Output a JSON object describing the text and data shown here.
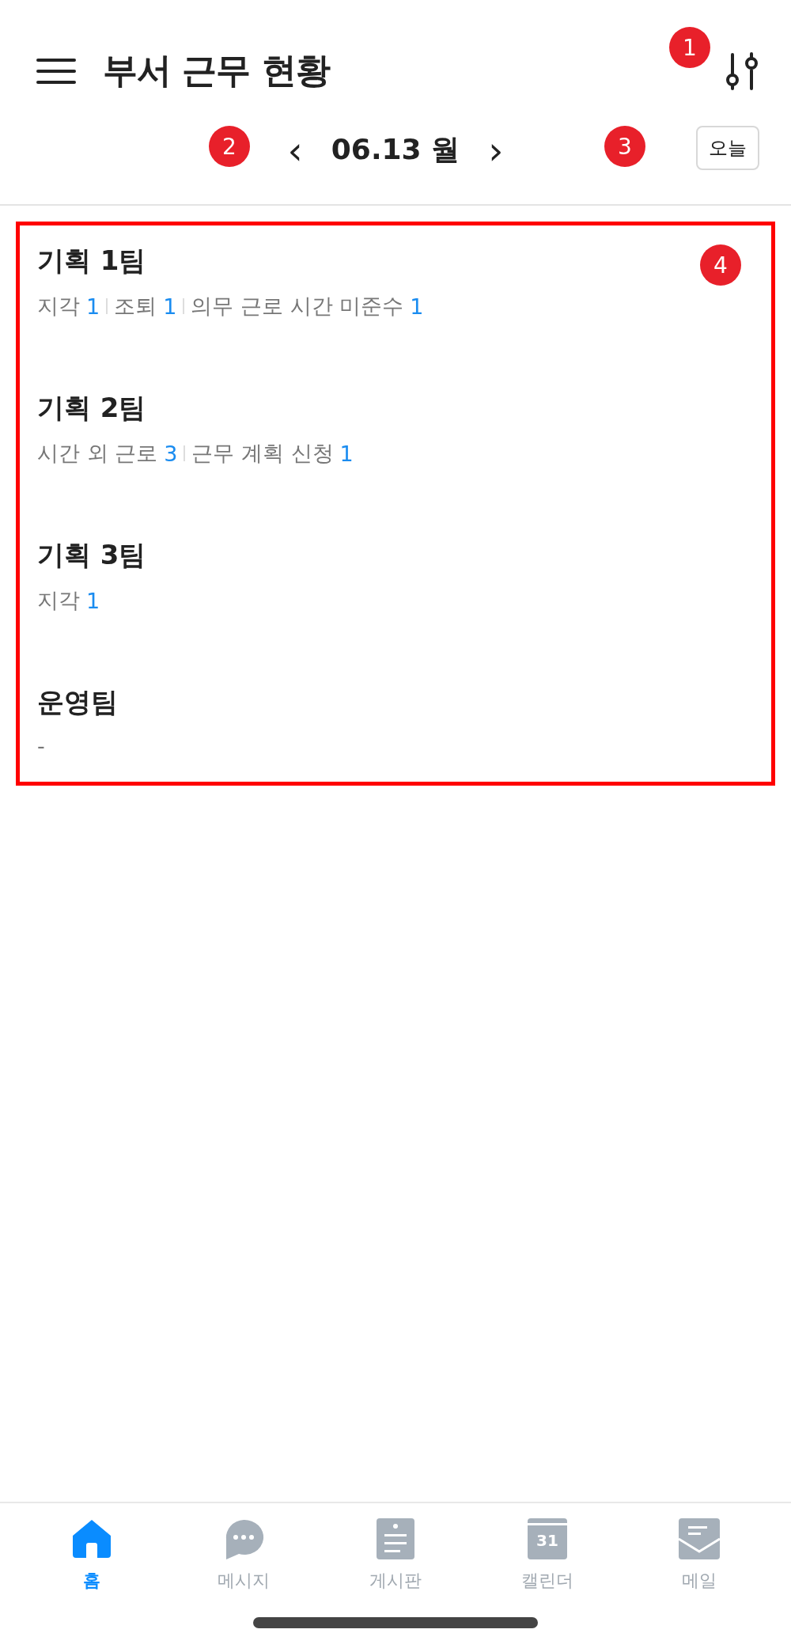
{
  "header": {
    "title": "부서 근무 현황"
  },
  "date_nav": {
    "prev": "‹",
    "date": "06.13 월",
    "next": "›",
    "today_button": "오늘"
  },
  "callouts": [
    {
      "kind": "filter",
      "label": "1"
    },
    {
      "kind": "date",
      "label": "2"
    },
    {
      "kind": "today",
      "label": "3"
    },
    {
      "kind": "list",
      "label": "4"
    }
  ],
  "teams": [
    {
      "name": "기획 1팀",
      "stats": [
        {
          "label": "지각",
          "count": "1"
        },
        {
          "label": "조퇴",
          "count": "1"
        },
        {
          "label": "의무 근로 시간 미준수",
          "count": "1"
        }
      ]
    },
    {
      "name": "기획 2팀",
      "stats": [
        {
          "label": "시간 외 근로",
          "count": "3"
        },
        {
          "label": "근무 계획 신청",
          "count": "1"
        }
      ]
    },
    {
      "name": "기획 3팀",
      "stats": [
        {
          "label": "지각",
          "count": "1"
        }
      ]
    },
    {
      "name": "운영팀",
      "empty_text": "-"
    }
  ],
  "tab_bar": [
    {
      "kind": "home",
      "label": "홈",
      "selected": true
    },
    {
      "kind": "message",
      "label": "메시지",
      "selected": false
    },
    {
      "kind": "board",
      "label": "게시판",
      "selected": false
    },
    {
      "kind": "calendar",
      "label": "캘린더",
      "selected": false,
      "icon_text": "31"
    },
    {
      "kind": "mail",
      "label": "메일",
      "selected": false
    }
  ]
}
